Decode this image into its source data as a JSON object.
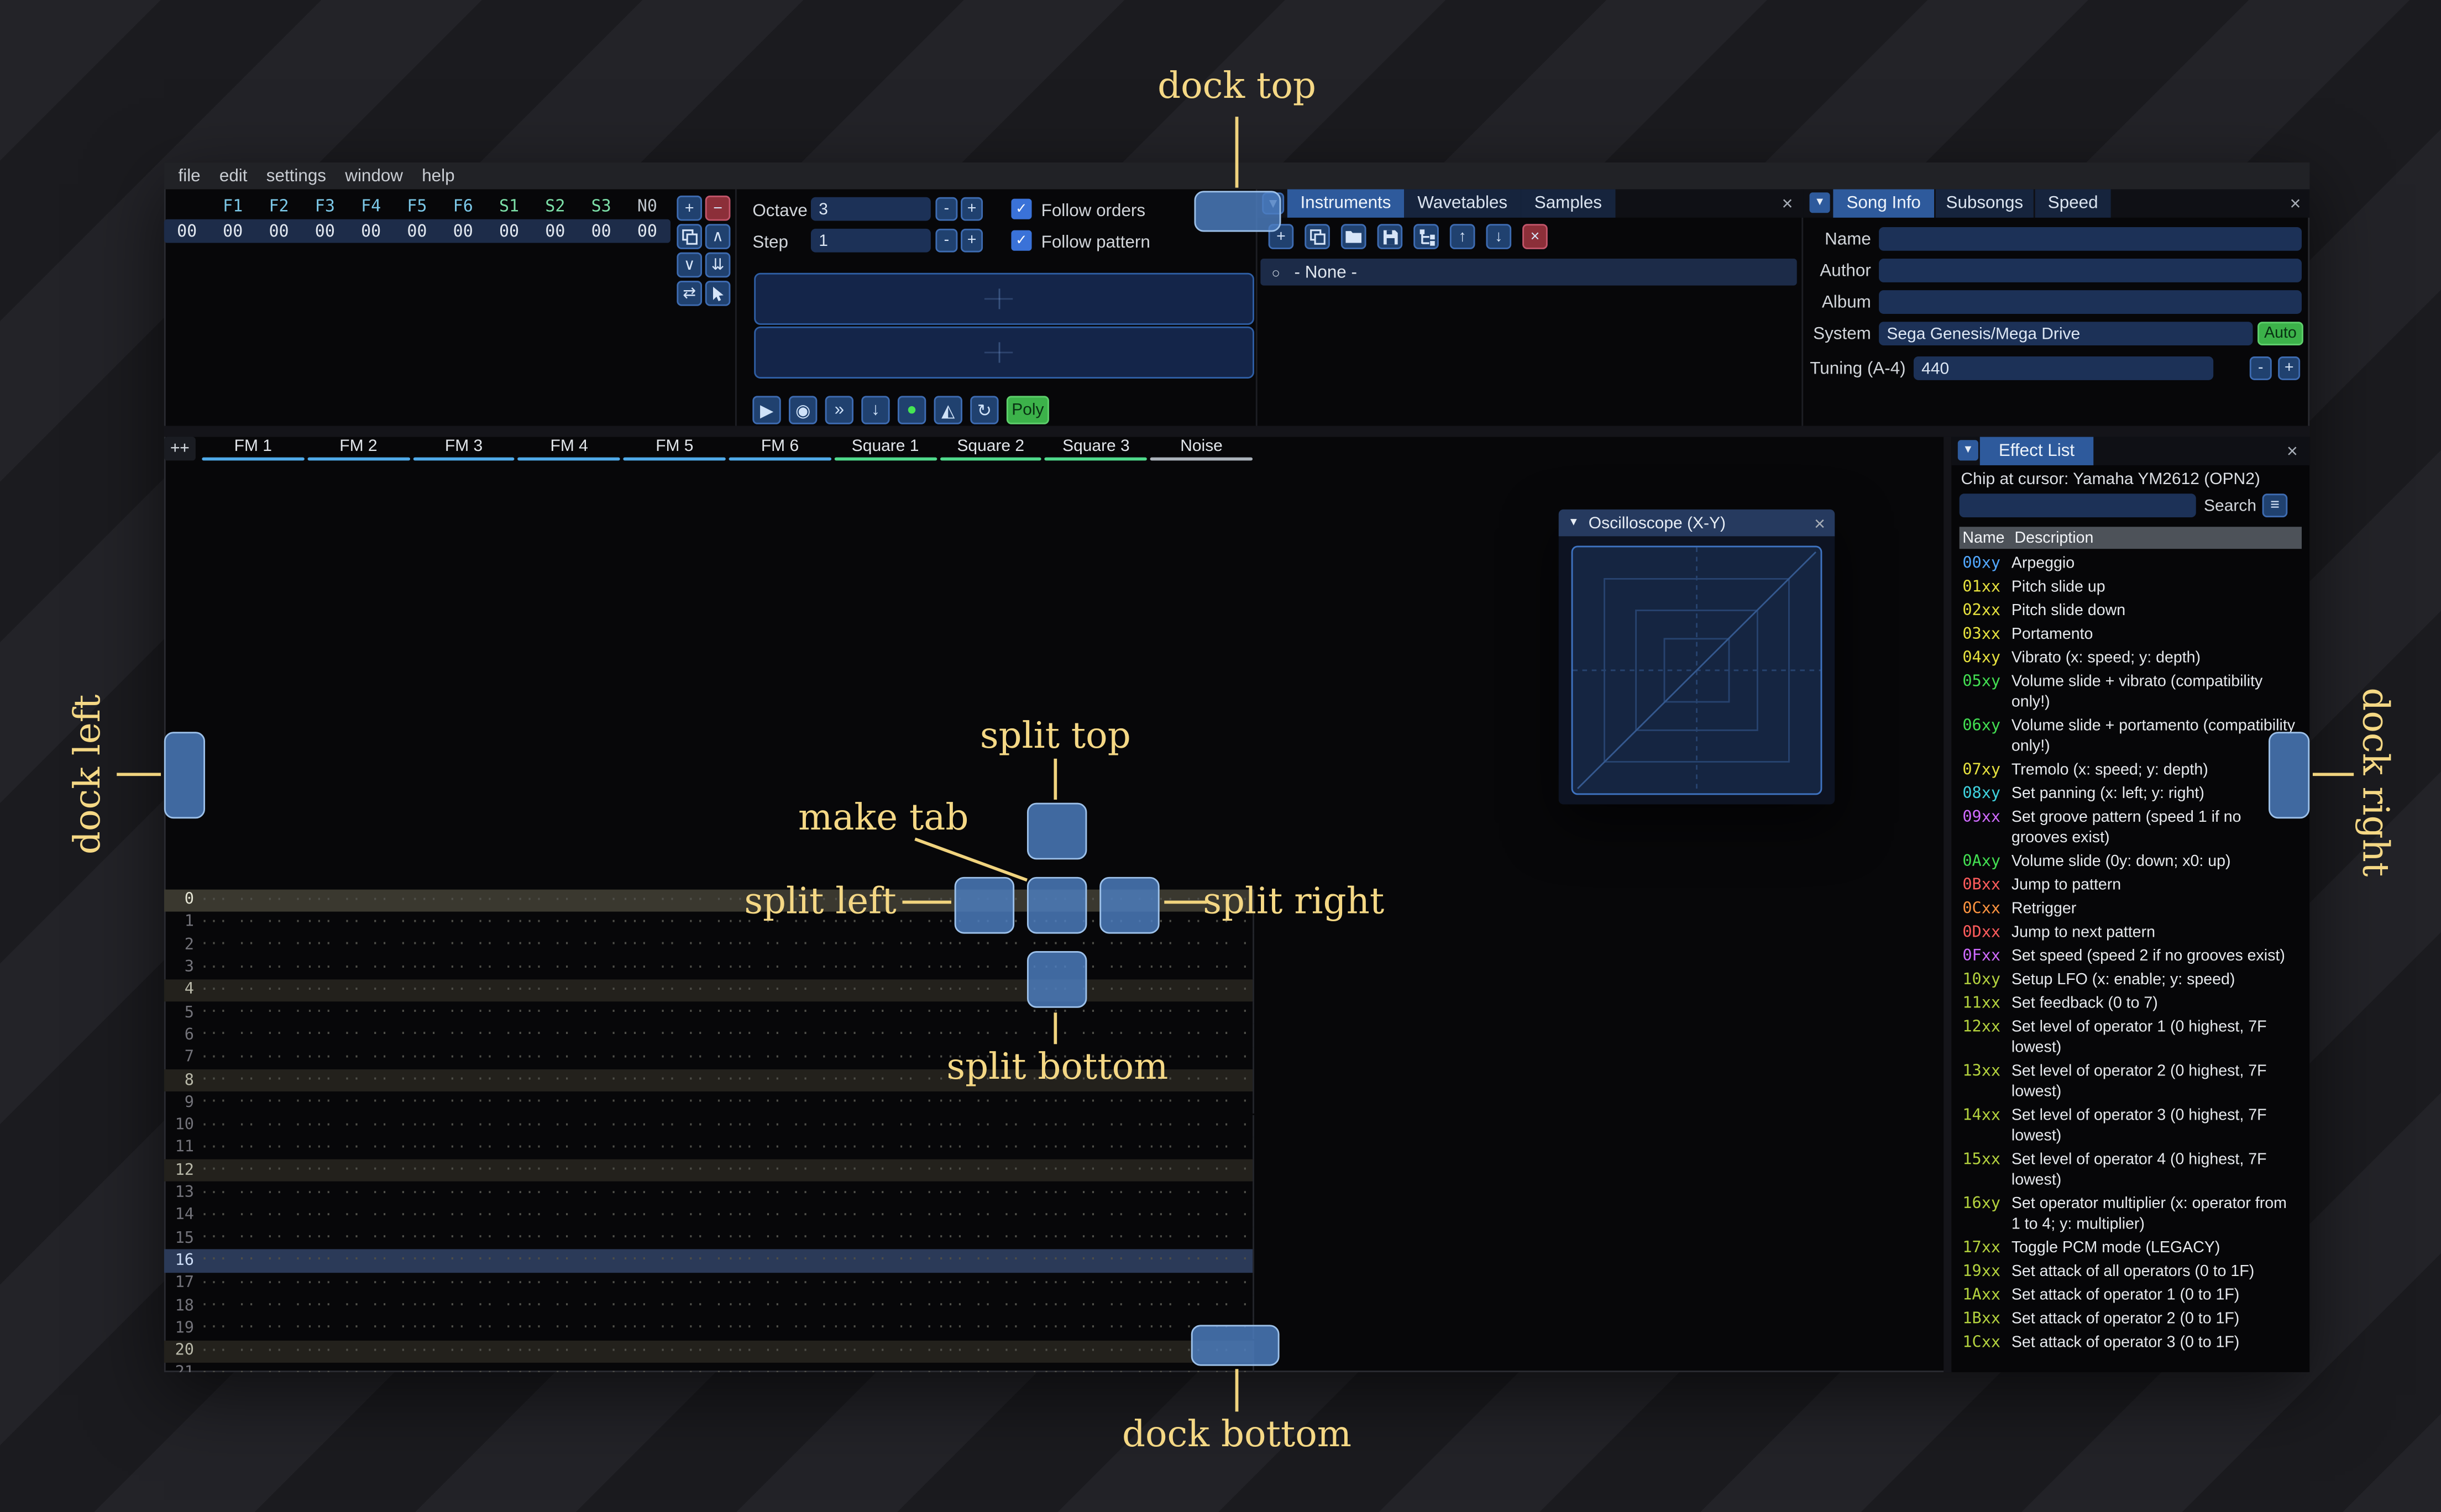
{
  "annotations": {
    "color": "#f5d885",
    "dock_top": "dock top",
    "dock_bottom": "dock bottom",
    "dock_left": "dock left",
    "dock_right": "dock right",
    "split_top": "split top",
    "split_bottom": "split bottom",
    "split_left": "split left",
    "split_right": "split right",
    "make_tab": "make tab"
  },
  "icons": {
    "tab_list_arrow": "▾",
    "collapse_arrow": "▼",
    "close": "×",
    "hamburger": "≡",
    "radio": "○",
    "check": "✓"
  },
  "menu": {
    "items": [
      "file",
      "edit",
      "settings",
      "window",
      "help"
    ]
  },
  "orders": {
    "index_cell": "00",
    "channels": [
      {
        "label": "F1",
        "value": "00",
        "color": "#7cc8e8"
      },
      {
        "label": "F2",
        "value": "00",
        "color": "#7cc8e8"
      },
      {
        "label": "F3",
        "value": "00",
        "color": "#7cc8e8"
      },
      {
        "label": "F4",
        "value": "00",
        "color": "#7cc8e8"
      },
      {
        "label": "F5",
        "value": "00",
        "color": "#7cc8e8"
      },
      {
        "label": "F6",
        "value": "00",
        "color": "#7cc8e8"
      },
      {
        "label": "S1",
        "value": "00",
        "color": "#7de0a8"
      },
      {
        "label": "S2",
        "value": "00",
        "color": "#7de0a8"
      },
      {
        "label": "S3",
        "value": "00",
        "color": "#7de0a8"
      },
      {
        "label": "N0",
        "value": "00",
        "color": "#bdc4cb"
      }
    ],
    "buttons": [
      {
        "name": "add-order-button",
        "glyph": "+",
        "variant": "blue"
      },
      {
        "name": "remove-order-button",
        "glyph": "−",
        "variant": "red"
      },
      {
        "name": "duplicate-order-button",
        "icon": "copy",
        "variant": "blue"
      },
      {
        "name": "move-order-up-button",
        "glyph": "∧",
        "variant": "blue"
      },
      {
        "name": "move-order-down-button",
        "glyph": "∨",
        "variant": "blue"
      },
      {
        "name": "duplicate-order-to-end-button",
        "glyph": "⇊",
        "variant": "blue"
      },
      {
        "name": "order-change-mode-button",
        "glyph": "⇄",
        "variant": "blue"
      },
      {
        "name": "order-edit-mode-button",
        "icon": "cursor",
        "variant": "blue"
      }
    ]
  },
  "controls": {
    "octave_label": "Octave",
    "octave_value": "3",
    "step_label": "Step",
    "step_value": "1",
    "minus_label": "-",
    "plus_label": "+",
    "follow_orders_label": "Follow orders",
    "follow_pattern_label": "Follow pattern",
    "transport": [
      {
        "name": "play-button",
        "glyph": "▶"
      },
      {
        "name": "stop-button",
        "glyph": "◉"
      },
      {
        "name": "play-from-cursor-button",
        "glyph": "»"
      },
      {
        "name": "step-one-row-button",
        "glyph": "↓"
      },
      {
        "name": "edit-record-toggle-button",
        "glyph": "●",
        "color": "#45e553"
      },
      {
        "name": "metronome-button",
        "glyph": "◭"
      },
      {
        "name": "repeat-pattern-button",
        "glyph": "↻"
      }
    ],
    "poly_label": "Poly"
  },
  "asset_panel": {
    "tabs": [
      {
        "label": "Instruments",
        "active": true
      },
      {
        "label": "Wavetables",
        "active": false
      },
      {
        "label": "Samples",
        "active": false
      }
    ],
    "toolbar": [
      {
        "name": "add-instrument-button",
        "glyph": "+",
        "variant": "blue"
      },
      {
        "name": "duplicate-instrument-button",
        "icon": "copy",
        "variant": "blue"
      },
      {
        "name": "open-instrument-button",
        "icon": "folder",
        "variant": "blue"
      },
      {
        "name": "save-instrument-button",
        "icon": "save",
        "variant": "blue"
      },
      {
        "name": "instrument-list-options-button",
        "icon": "tree",
        "variant": "blue"
      },
      {
        "name": "move-instrument-up-button",
        "glyph": "↑",
        "variant": "blue"
      },
      {
        "name": "move-instrument-down-button",
        "glyph": "↓",
        "variant": "blue"
      },
      {
        "name": "delete-instrument-button",
        "glyph": "×",
        "variant": "red"
      }
    ],
    "list": [
      {
        "label": "- None -",
        "selected": true
      }
    ]
  },
  "song_info": {
    "tabs": [
      {
        "label": "Song Info",
        "active": true
      },
      {
        "label": "Subsongs",
        "active": false
      },
      {
        "label": "Speed",
        "active": false
      }
    ],
    "fields": [
      {
        "label": "Name",
        "value": ""
      },
      {
        "label": "Author",
        "value": ""
      },
      {
        "label": "Album",
        "value": ""
      }
    ],
    "system_label": "System",
    "system_value": "Sega Genesis/Mega Drive",
    "auto_label": "Auto",
    "tuning_label": "Tuning (A-4)",
    "tuning_value": "440",
    "minus_label": "-",
    "plus_label": "+"
  },
  "pattern": {
    "expand_label": "++",
    "channels": [
      {
        "name": "FM 1",
        "color": "#4fa9e8"
      },
      {
        "name": "FM 2",
        "color": "#4fa9e8"
      },
      {
        "name": "FM 3",
        "color": "#4fa9e8"
      },
      {
        "name": "FM 4",
        "color": "#4fa9e8"
      },
      {
        "name": "FM 5",
        "color": "#4fa9e8"
      },
      {
        "name": "FM 6",
        "color": "#4fa9e8"
      },
      {
        "name": "Square 1",
        "color": "#4fd98b"
      },
      {
        "name": "Square 2",
        "color": "#4fd98b"
      },
      {
        "name": "Square 3",
        "color": "#4fd98b"
      },
      {
        "name": "Noise",
        "color": "#aab2ba"
      }
    ],
    "row_count": 22,
    "empty_cell": "··· ·· ·· ···",
    "strong_rows": [
      0
    ],
    "weak_rows": [
      4,
      8,
      12,
      20
    ],
    "playhead_row": 16
  },
  "oscilloscope": {
    "title": "Oscilloscope (X-Y)"
  },
  "effect_list": {
    "tab_label": "Effect List",
    "chip_line": "Chip at cursor: Yamaha YM2612 (OPN2)",
    "search_label": "Search",
    "search_value": "",
    "columns": {
      "name": "Name",
      "description": "Description"
    },
    "effects": [
      {
        "code": "00xy",
        "color": "#52a8ff",
        "desc": "Arpeggio"
      },
      {
        "code": "01xx",
        "color": "#e6e13e",
        "desc": "Pitch slide up"
      },
      {
        "code": "02xx",
        "color": "#e6e13e",
        "desc": "Pitch slide down"
      },
      {
        "code": "03xx",
        "color": "#e6e13e",
        "desc": "Portamento"
      },
      {
        "code": "04xy",
        "color": "#e6e13e",
        "desc": "Vibrato (x: speed; y: depth)"
      },
      {
        "code": "05xy",
        "color": "#43df52",
        "desc": "Volume slide + vibrato (compatibility only!)"
      },
      {
        "code": "06xy",
        "color": "#43df52",
        "desc": "Volume slide + portamento (compatibility only!)"
      },
      {
        "code": "07xy",
        "color": "#e6e13e",
        "desc": "Tremolo (x: speed; y: depth)"
      },
      {
        "code": "08xy",
        "color": "#3fd2df",
        "desc": "Set panning (x: left; y: right)"
      },
      {
        "code": "09xx",
        "color": "#cf6bff",
        "desc": "Set groove pattern (speed 1 if no grooves exist)"
      },
      {
        "code": "0Axy",
        "color": "#43df52",
        "desc": "Volume slide (0y: down; x0: up)"
      },
      {
        "code": "0Bxx",
        "color": "#ff5c5c",
        "desc": "Jump to pattern"
      },
      {
        "code": "0Cxx",
        "color": "#ff9440",
        "desc": "Retrigger"
      },
      {
        "code": "0Dxx",
        "color": "#ff5c5c",
        "desc": "Jump to next pattern"
      },
      {
        "code": "0Fxx",
        "color": "#cf6bff",
        "desc": "Set speed (speed 2 if no grooves exist)"
      },
      {
        "code": "10xy",
        "color": "#b4d23e",
        "desc": "Setup LFO (x: enable; y: speed)"
      },
      {
        "code": "11xx",
        "color": "#b4d23e",
        "desc": "Set feedback (0 to 7)"
      },
      {
        "code": "12xx",
        "color": "#b4d23e",
        "desc": "Set level of operator 1 (0 highest, 7F lowest)"
      },
      {
        "code": "13xx",
        "color": "#b4d23e",
        "desc": "Set level of operator 2 (0 highest, 7F lowest)"
      },
      {
        "code": "14xx",
        "color": "#b4d23e",
        "desc": "Set level of operator 3 (0 highest, 7F lowest)"
      },
      {
        "code": "15xx",
        "color": "#b4d23e",
        "desc": "Set level of operator 4 (0 highest, 7F lowest)"
      },
      {
        "code": "16xy",
        "color": "#b4d23e",
        "desc": "Set operator multiplier (x: operator from 1 to 4; y: multiplier)"
      },
      {
        "code": "17xx",
        "color": "#b4d23e",
        "desc": "Toggle PCM mode (LEGACY)"
      },
      {
        "code": "19xx",
        "color": "#b4d23e",
        "desc": "Set attack of all operators (0 to 1F)"
      },
      {
        "code": "1Axx",
        "color": "#b4d23e",
        "desc": "Set attack of operator 1 (0 to 1F)"
      },
      {
        "code": "1Bxx",
        "color": "#b4d23e",
        "desc": "Set attack of operator 2 (0 to 1F)"
      },
      {
        "code": "1Cxx",
        "color": "#b4d23e",
        "desc": "Set attack of operator 3 (0 to 1F)"
      }
    ]
  }
}
